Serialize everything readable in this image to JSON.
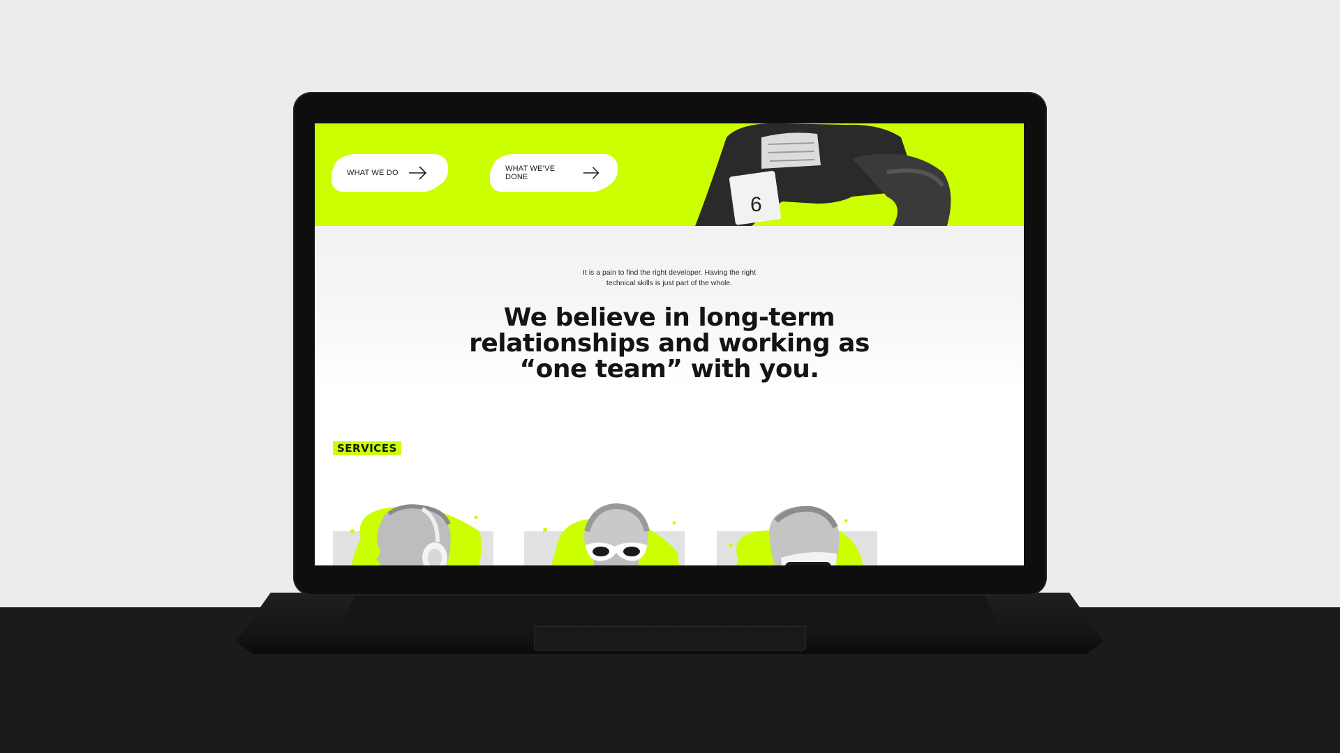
{
  "hero": {
    "buttons": [
      {
        "label": "WHAT WE DO"
      },
      {
        "label": "WHAT WE’VE DONE"
      }
    ],
    "athlete_bib_number": "6"
  },
  "intro": {
    "line1": "It is a pain to find the right developer. Having the right",
    "line2": "technical skills is just part of the whole."
  },
  "headline": {
    "line1": "We believe in long-term",
    "line2": "relationships and working as",
    "open_quote": "“",
    "highlight": "one team",
    "close": "” with you."
  },
  "services": {
    "label": "SERVICES",
    "cards": [
      {
        "icon": "statue-headphones-icon"
      },
      {
        "icon": "statue-sunglasses-icon"
      },
      {
        "icon": "statue-vr-headset-icon"
      }
    ]
  },
  "colors": {
    "accent": "#ccff00",
    "text": "#141414",
    "background": "#ececec",
    "laptop": "#0e0e0e"
  }
}
